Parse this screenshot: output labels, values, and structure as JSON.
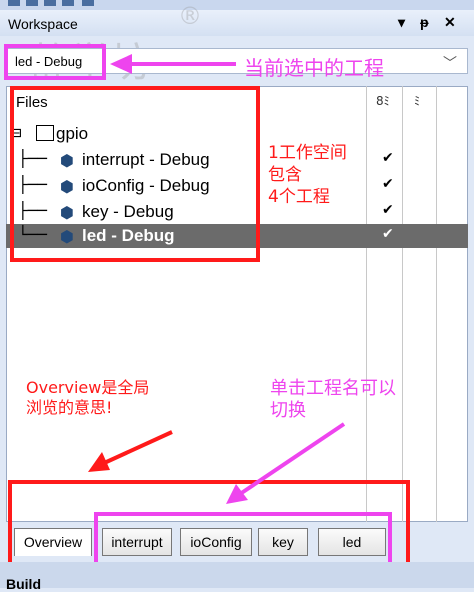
{
  "header": {
    "title": "Workspace",
    "dropdown_icon": "▾",
    "pin_icon": "ᵽ",
    "close_icon": "✕"
  },
  "project_selector": {
    "selected": "led - Debug",
    "arrow": "﹀"
  },
  "file_tree": {
    "header": "Files",
    "col1_icon": "8ﾐ",
    "col2_icon": "ﾐ",
    "workspace": "gpio",
    "projects": [
      {
        "label": "interrupt - Debug",
        "checked": "✔"
      },
      {
        "label": "ioConfig - Debug",
        "checked": "✔"
      },
      {
        "label": "key - Debug",
        "checked": "✔"
      },
      {
        "label": "led - Debug",
        "checked": "✔"
      }
    ]
  },
  "annotations": {
    "current_project": "当前选中的工程",
    "workspace_line1": "1工作空间",
    "workspace_line2": "包含",
    "workspace_line3": "4个工程",
    "overview_line1": "Overview是全局",
    "overview_line2": "浏览的意思!",
    "switch_line1": "单击工程名可以",
    "switch_line2": "切换"
  },
  "tabs": [
    {
      "label": "Overview",
      "active": true
    },
    {
      "label": "interrupt"
    },
    {
      "label": "ioConfig"
    },
    {
      "label": "key"
    },
    {
      "label": "led"
    }
  ],
  "bottom_bar": {
    "label": "Build"
  },
  "colors": {
    "red_annotation": "#ff1a1a",
    "magenta_annotation": "#ee44ee",
    "selection": "#6b6b6b"
  }
}
